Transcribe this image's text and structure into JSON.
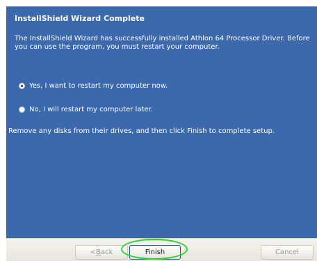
{
  "wizard": {
    "title": "InstallShield Wizard Complete",
    "message": "The InstallShield Wizard has successfully installed Athlon 64 Processor Driver.  Before you can use the program, you must restart your computer.",
    "restart_options": [
      {
        "label": "Yes, I want to restart my computer now.",
        "selected": true
      },
      {
        "label": "No, I will restart my computer later.",
        "selected": false
      }
    ],
    "remove_disks_note": "Remove any disks from their drives, and then click Finish to complete setup."
  },
  "buttons": {
    "back": {
      "prefix": "< ",
      "accel": "B",
      "rest": "ack",
      "enabled": false
    },
    "finish": {
      "label": "Finish",
      "enabled": true
    },
    "cancel": {
      "label": "Cancel",
      "enabled": false
    }
  },
  "colors": {
    "panel_background": "#3c69ae",
    "annotation_circle": "#22d822"
  }
}
